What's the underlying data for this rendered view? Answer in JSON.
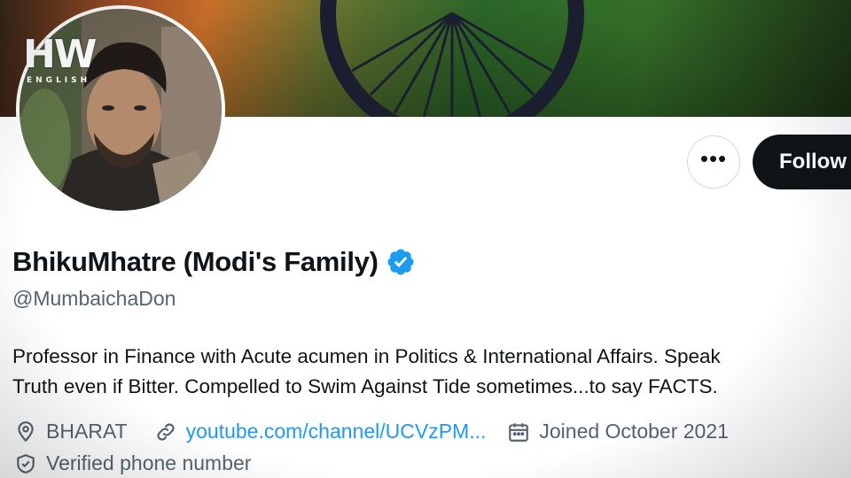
{
  "watermark": {
    "mark": "HW",
    "sub": "ENGLISH"
  },
  "profile": {
    "display_name": "BhikuMhatre (Modi's Family)",
    "handle": "@MumbaichaDon",
    "bio_line1": "Professor in Finance with Acute acumen in Politics & International Affairs. Speak",
    "bio_line2": "Truth even if Bitter. Compelled to Swim Against Tide sometimes...to say FACTS.",
    "location": "BHARAT",
    "website": "youtube.com/channel/UCVzPM...",
    "joined": "Joined October 2021",
    "verified_phone": "Verified phone number"
  },
  "actions": {
    "more_label": "•••",
    "follow_label": "Follow"
  },
  "colors": {
    "accent": "#1d9bf0",
    "text": "#0f1419",
    "muted": "#536471",
    "follow_bg": "#0f1419"
  },
  "icons": {
    "more": "more-icon",
    "verified": "verified-badge-icon",
    "location": "location-pin-icon",
    "link": "link-icon",
    "calendar": "calendar-icon",
    "shield": "shield-check-icon"
  }
}
